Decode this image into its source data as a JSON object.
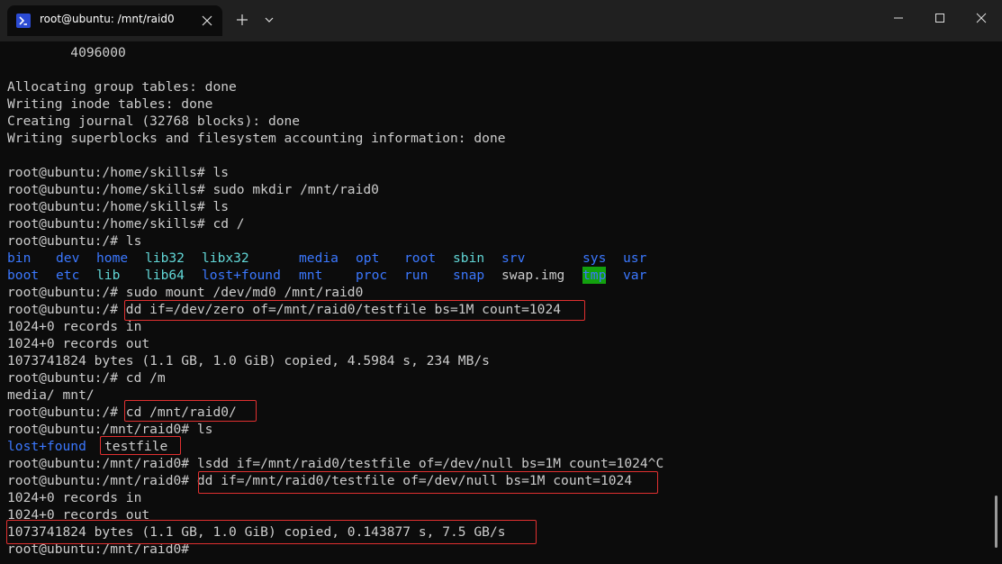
{
  "window": {
    "tab_title": "root@ubuntu: /mnt/raid0",
    "tab_icon": "powershell-icon",
    "close_tab_icon": "close-icon",
    "new_tab_icon": "plus-icon",
    "dropdown_icon": "chevron-down-icon",
    "minimize_icon": "minimize-icon",
    "maximize_icon": "maximize-icon",
    "close_icon": "close-icon"
  },
  "colors": {
    "terminal_bg": "#0c0c0c",
    "titlebar_bg": "#202020",
    "text": "#cccccc",
    "dir_blue": "#3b78ff",
    "link_cyan": "#61d6d6",
    "tmp_bg": "#13a10e",
    "highlight": "#e03030"
  },
  "terminal": {
    "lines": [
      "        4096000",
      "",
      "Allocating group tables: done",
      "Writing inode tables: done",
      "Creating journal (32768 blocks): done",
      "Writing superblocks and filesystem accounting information: done",
      "",
      "root@ubuntu:/home/skills# ls",
      "root@ubuntu:/home/skills# sudo mkdir /mnt/raid0",
      "root@ubuntu:/home/skills# ls",
      "root@ubuntu:/home/skills# cd /",
      "root@ubuntu:/# ls",
      "",
      "",
      "root@ubuntu:/# sudo mount /dev/md0 /mnt/raid0",
      "root@ubuntu:/# dd if=/dev/zero of=/mnt/raid0/testfile bs=1M count=1024",
      "1024+0 records in",
      "1024+0 records out",
      "1073741824 bytes (1.1 GB, 1.0 GiB) copied, 4.5984 s, 234 MB/s",
      "root@ubuntu:/# cd /m",
      "media/ mnt/",
      "root@ubuntu:/# cd /mnt/raid0/",
      "root@ubuntu:/mnt/raid0# ls",
      "",
      "root@ubuntu:/mnt/raid0# lsdd if=/mnt/raid0/testfile of=/dev/null bs=1M count=1024^C",
      "root@ubuntu:/mnt/raid0# dd if=/mnt/raid0/testfile of=/dev/null bs=1M count=1024",
      "1024+0 records in",
      "1024+0 records out",
      "1073741824 bytes (1.1 GB, 1.0 GiB) copied, 0.143877 s, 7.5 GB/s",
      "root@ubuntu:/mnt/raid0#"
    ],
    "ls_root_row1": [
      "bin",
      "dev",
      "home",
      "lib32",
      "libx32",
      "media",
      "opt",
      "root",
      "sbin",
      "srv",
      "sys",
      "usr"
    ],
    "ls_root_row2": [
      "boot",
      "etc",
      "lib",
      "lib64",
      "lost+found",
      "mnt",
      "proc",
      "run",
      "snap",
      "swap.img",
      "tmp",
      "var"
    ],
    "ls_raid0": [
      "lost+found",
      "testfile"
    ]
  }
}
